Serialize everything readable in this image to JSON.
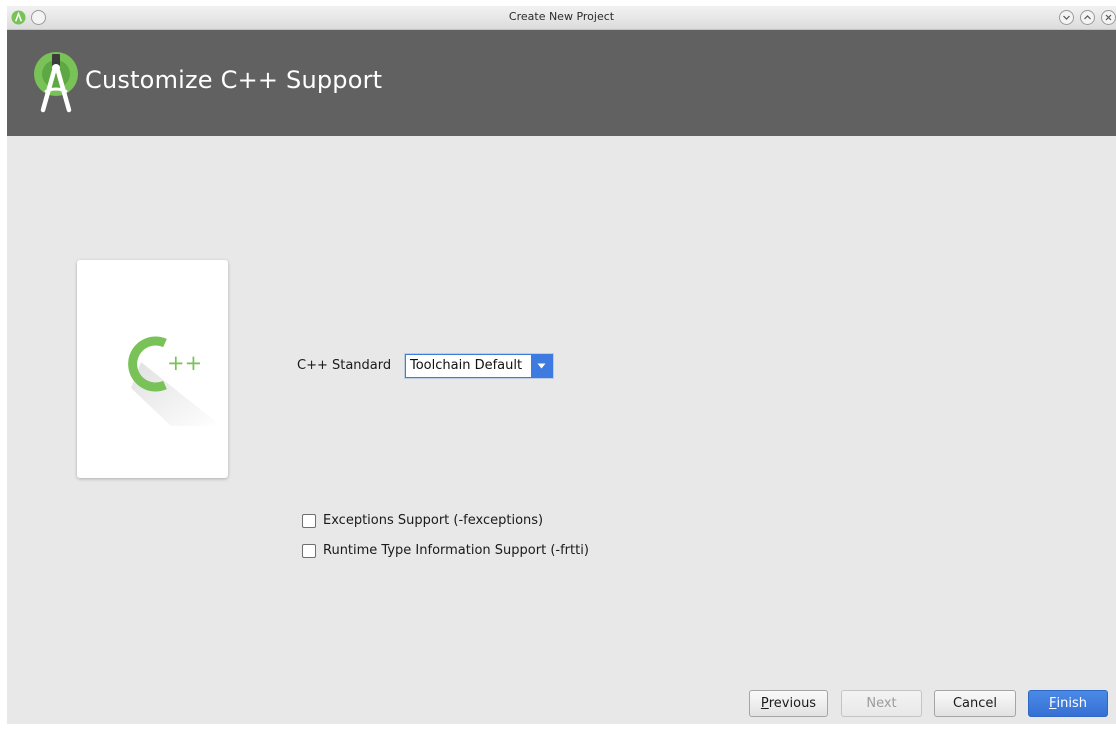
{
  "window": {
    "title": "Create New Project"
  },
  "header": {
    "title": "Customize C++ Support"
  },
  "card": {
    "logo_text": "C++"
  },
  "form": {
    "cpp_standard": {
      "label": "C++ Standard",
      "selected": "Toolchain Default"
    },
    "checkboxes": [
      {
        "label": "Exceptions Support (-fexceptions)",
        "checked": false
      },
      {
        "label": "Runtime Type Information Support (-frtti)",
        "checked": false
      }
    ]
  },
  "buttons": {
    "previous": {
      "mnemonic": "P",
      "rest": "revious",
      "enabled": true
    },
    "next": {
      "label": "Next",
      "enabled": false
    },
    "cancel": {
      "label": "Cancel",
      "enabled": true
    },
    "finish": {
      "mnemonic": "F",
      "rest": "inish",
      "enabled": true,
      "primary": true
    }
  },
  "colors": {
    "header_bg": "#616161",
    "android_green": "#78c257",
    "accent_blue": "#3d7be0",
    "window_bg": "#e8e8e8"
  },
  "icons": {
    "app": "android-studio-icon",
    "title_menu": "window-menu-icon",
    "minimize": "minimize-icon",
    "maximize": "maximize-icon",
    "close": "close-icon",
    "combo_arrow": "chevron-down-icon",
    "header_logo": "android-studio-logo",
    "card_logo": "cpp-logo"
  }
}
